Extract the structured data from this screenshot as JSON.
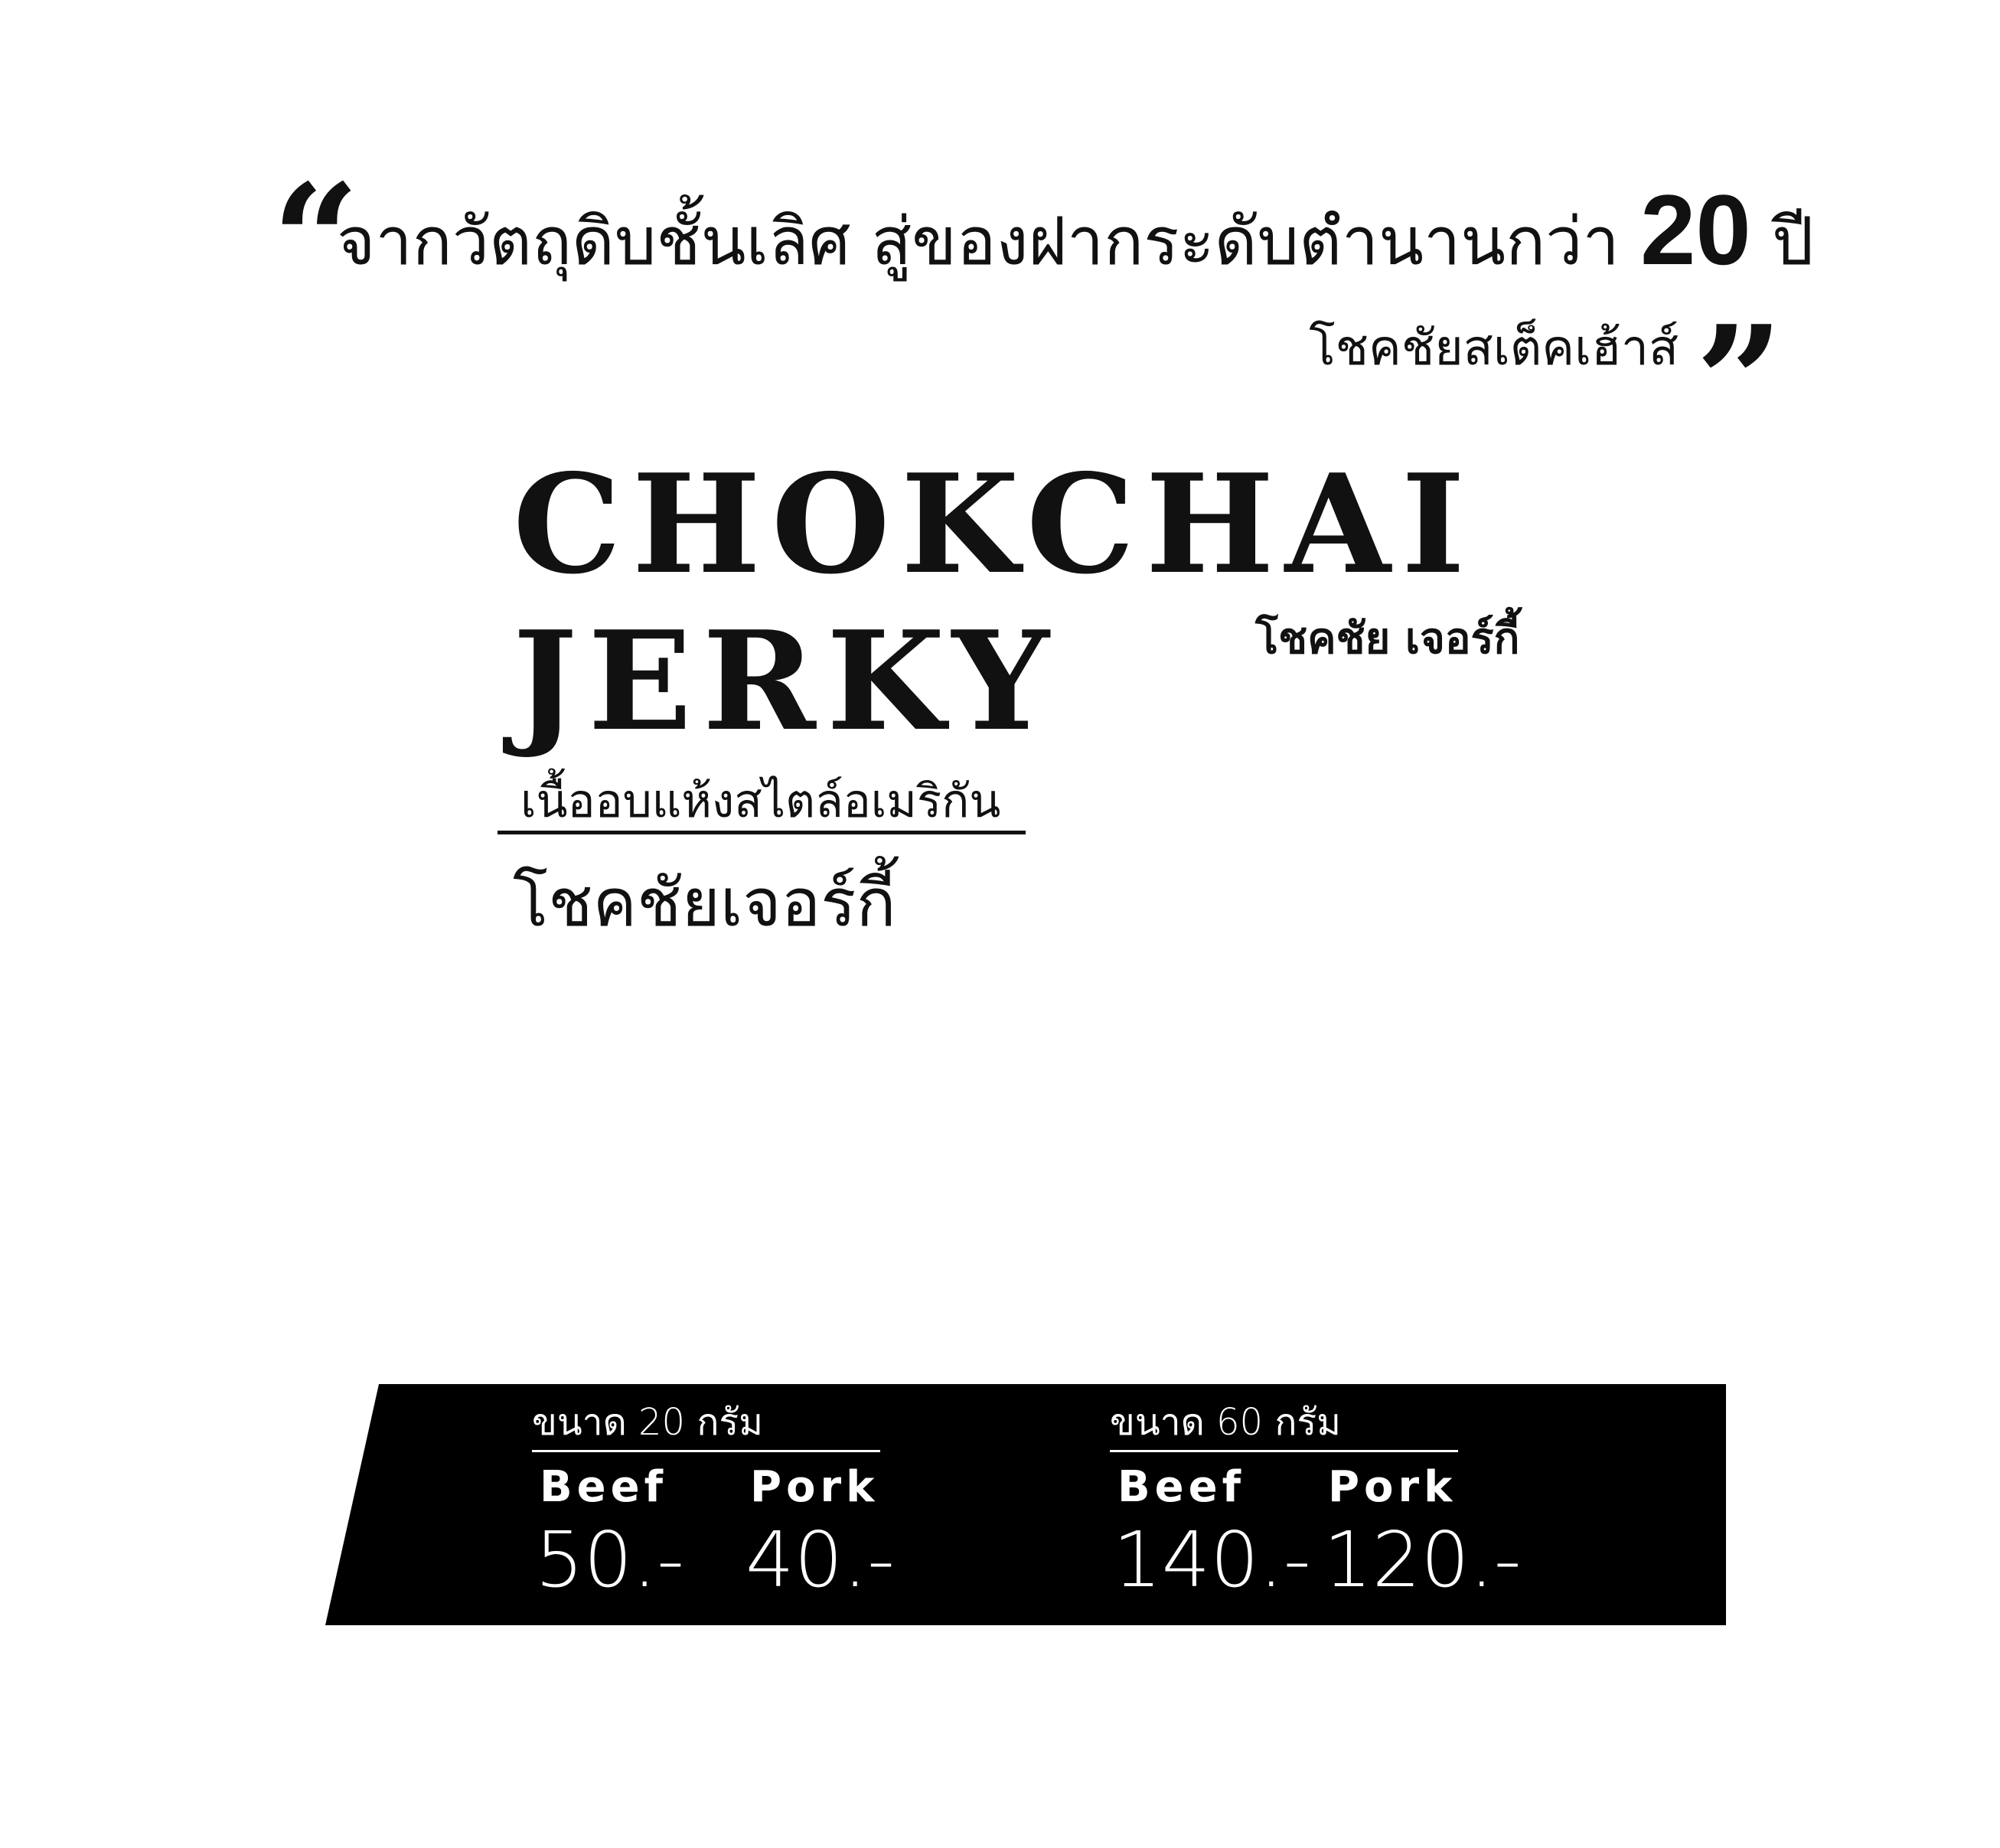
{
  "quote": {
    "open_mark": "“",
    "line1_text": "จากวัตถุดิบชั้นเลิศ  สู่ของฝากระดับตำนานกว่า",
    "line1_number": "20",
    "line1_suffix": "ปี",
    "line2": "โชคชัยสเต็คเฮ้าส์",
    "close_mark": "”"
  },
  "brand": {
    "line1": "CHOKCHAI",
    "line2": "JERKY",
    "thai_small": "โชคชัย เจอร์กี้",
    "tagline": "เนื้ออบแห้งสไตล์อเมริกัน",
    "thai_name": "โชคชัยเจอร์กี้"
  },
  "prices": {
    "banner_color": "#000000",
    "text_color": "#ffffff",
    "groups": [
      {
        "size_label": "ขนาด 20 กรัม",
        "items": [
          {
            "flavor": "Beef",
            "price": "50.-"
          },
          {
            "flavor": "Pork",
            "price": "40.-"
          }
        ]
      },
      {
        "size_label": "ขนาด 60 กรัม",
        "items": [
          {
            "flavor": "Beef",
            "price": "140.-"
          },
          {
            "flavor": "Pork",
            "price": "120.-"
          }
        ]
      }
    ]
  }
}
